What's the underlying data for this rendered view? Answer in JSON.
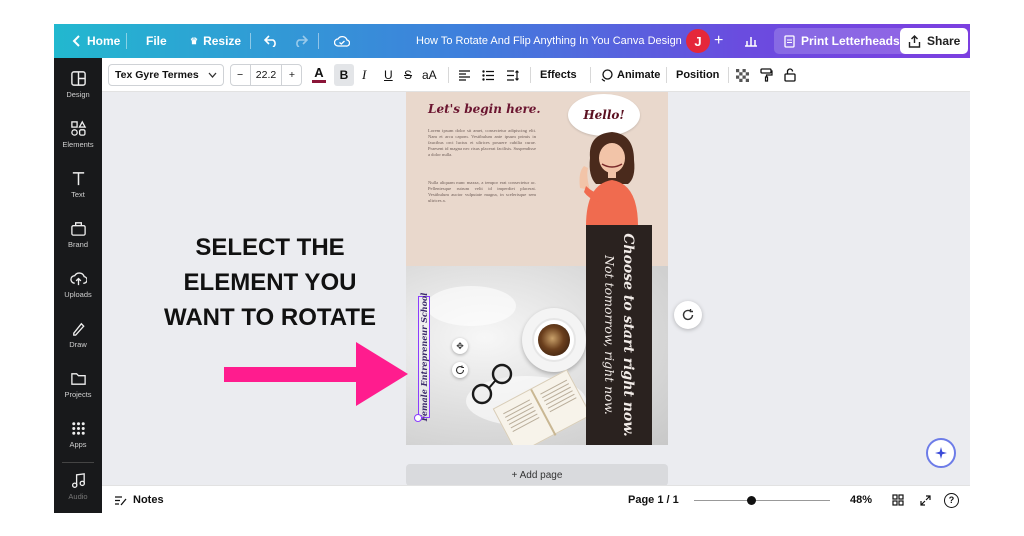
{
  "topbar": {
    "home": "Home",
    "file": "File",
    "resize": "Resize",
    "doc_title": "How To Rotate And Flip Anything In You Canva Design",
    "avatar_initial": "J",
    "print_label": "Print Letterheads",
    "share_label": "Share"
  },
  "sidebar": {
    "items": [
      {
        "label": "Design",
        "icon": "layout-icon"
      },
      {
        "label": "Elements",
        "icon": "shapes-icon"
      },
      {
        "label": "Text",
        "icon": "text-icon"
      },
      {
        "label": "Brand",
        "icon": "brand-icon"
      },
      {
        "label": "Uploads",
        "icon": "upload-cloud-icon"
      },
      {
        "label": "Draw",
        "icon": "pen-icon"
      },
      {
        "label": "Projects",
        "icon": "folder-icon"
      },
      {
        "label": "Apps",
        "icon": "grid-icon"
      },
      {
        "label": "Audio",
        "icon": "music-icon"
      }
    ]
  },
  "toolbar": {
    "font_family": "Tex Gyre Termes",
    "font_size": "22.2",
    "minus": "−",
    "plus": "+",
    "letter_a": "A",
    "bold": "B",
    "italic": "I",
    "underline": "U",
    "strike": "S",
    "case": "aA",
    "effects": "Effects",
    "animate": "Animate",
    "position": "Position"
  },
  "design": {
    "heading": "Let's begin here.",
    "para1": "Lorem ipsum dolor sit amet, consectetur adipiscing elit. Nam et arcu capom. Vestibulum ante ipsum primis in faucibus orci luctus et ultrices posuere cubilia curae. Praesent id magna nec risus placerat facilisis. Suspendisse a dolor nulla.",
    "para2": "Nulla aliquam nunc mazza, a tempor erat consectetur ac. Pellentesque rutrum velit id imperdiet placerat. Vestibulum auctor vulputate magna, in scelerisque sem ultrices a.",
    "bubble": "Hello!",
    "panel_line1": "Choose to start right now.",
    "panel_line2": "Not tomorrow, right now.",
    "selected_text": "Female Entrepreneur School"
  },
  "add_page": "+ Add page",
  "bottombar": {
    "notes": "Notes",
    "page": "Page 1 / 1",
    "zoom": "48%",
    "zoom_level": 0.42,
    "help": "?"
  },
  "annotation": {
    "line1": "SELECT THE",
    "line2": "ELEMENT YOU",
    "line3": "WANT TO ROTATE"
  },
  "colors": {
    "accent": "#8b3dff",
    "arrow": "#ff1c8e",
    "panel": "#2a221f",
    "avatar": "#e5273a"
  }
}
